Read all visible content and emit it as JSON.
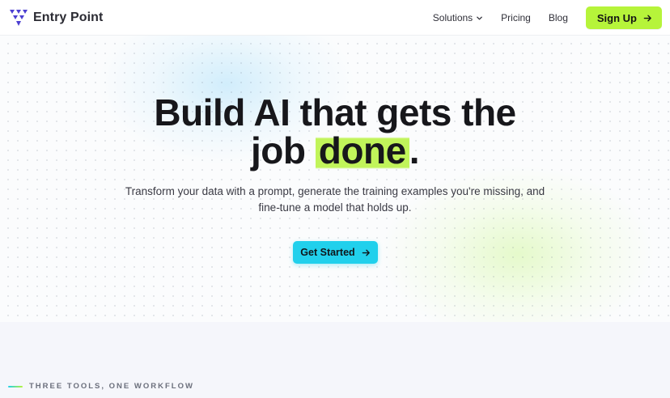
{
  "brand": {
    "name": "Entry Point",
    "logo_icon": "triangle-grid-logo",
    "logo_color": "#4b3fd1"
  },
  "nav": {
    "links": [
      {
        "label": "Solutions",
        "has_dropdown": true
      },
      {
        "label": "Pricing"
      },
      {
        "label": "Blog"
      }
    ],
    "signup_label": "Sign Up",
    "signup_color": "#b6f43a"
  },
  "hero": {
    "headline_line1": "Build AI that gets the",
    "headline_line2_before": "job ",
    "headline_highlight": "done",
    "headline_line2_after": ".",
    "highlight_color": "#c1f45a",
    "subtitle_line1": "Transform your data with a prompt, generate the training examples you're missing, and",
    "subtitle_line2": "fine-tune a model that holds up.",
    "cta_label": "Get Started",
    "cta_color": "#21d0ec"
  },
  "section": {
    "eyebrow": "THREE TOOLS, ONE WORKFLOW"
  }
}
